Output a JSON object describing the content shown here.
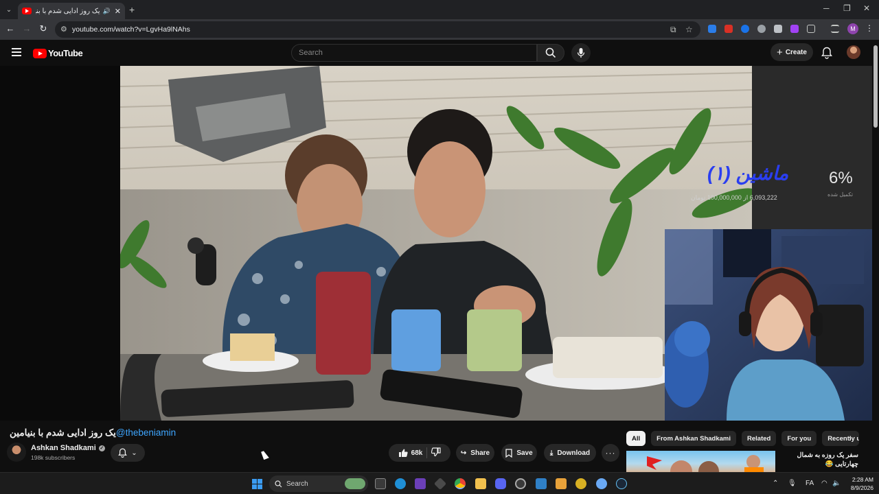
{
  "browser": {
    "tab_title": "یک روز ادایی شدم با بنیامین",
    "url": "youtube.com/watch?v=LgvHa9lNAhs"
  },
  "header": {
    "logo_text": "YouTube",
    "search_placeholder": "Search",
    "create_label": "Create"
  },
  "overlay": {
    "goal_title": "ماشین (۱)",
    "goal_amount": "6,093,222 از 100,000,000 تومان",
    "percent": "6%",
    "percent_caption": "تکمیل شده"
  },
  "video": {
    "title": "یک روز ادایی شدم با بنیامین",
    "title_handle": "@thebeniamin",
    "channel_name": "Ashkan Shadkami",
    "subscribers": "198k subscribers",
    "likes": "68k",
    "share_label": "Share",
    "save_label": "Save",
    "download_label": "Download"
  },
  "sidebar": {
    "chips": [
      {
        "label": "All",
        "active": true
      },
      {
        "label": "From Ashkan Shadkami",
        "active": false
      },
      {
        "label": "Related",
        "active": false
      },
      {
        "label": "For you",
        "active": false
      },
      {
        "label": "Recently uploaded",
        "active": false
      }
    ],
    "rec_title": "سفر یک روزه به شمال چهارتایی 😂"
  },
  "taskbar": {
    "search_label": "Search",
    "time": "2:28 AM",
    "date": "8/9/2026",
    "lang": "FA"
  },
  "colors": {
    "accent_red": "#ff0000",
    "link_blue": "#3ea6ff",
    "goal_blue": "#2a3ef0"
  }
}
